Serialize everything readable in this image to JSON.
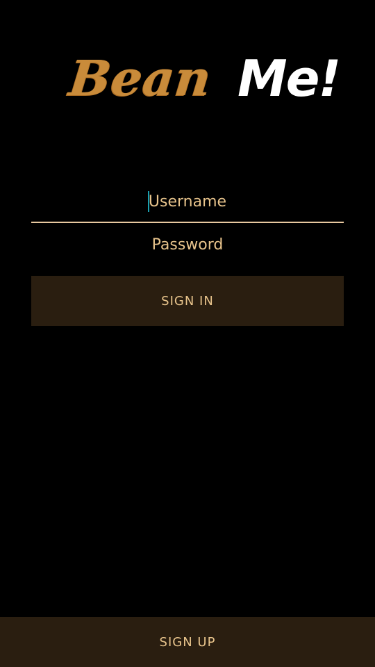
{
  "logo": {
    "part1": "Bean",
    "part2": "Me!",
    "part1_color": "#c98b3a",
    "part2_color": "#ffffff"
  },
  "form": {
    "username_placeholder": "Username",
    "username_value": "",
    "password_placeholder": "Password",
    "password_value": "",
    "signin_label": "SIGN IN"
  },
  "footer": {
    "signup_label": "SIGN UP"
  },
  "colors": {
    "background": "#000000",
    "accent": "#e8c48c",
    "button_bg": "#2a1e10",
    "caret": "#1a9fae"
  }
}
